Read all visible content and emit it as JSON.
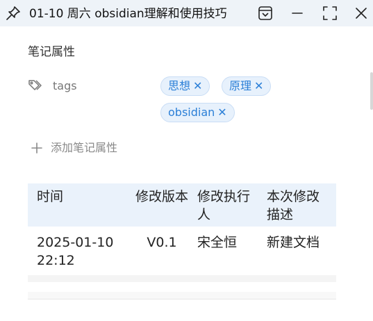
{
  "window": {
    "title": "01-10 周六 obsidian理解和使用技巧"
  },
  "properties": {
    "heading": "笔记属性",
    "tags_key": "tags",
    "tags": [
      "思想",
      "原理",
      "obsidian"
    ],
    "tag_remove_glyph": "✕",
    "add_label": "添加笔记属性"
  },
  "table": {
    "headers": [
      "时间",
      "修改版本",
      "修改执行人",
      "本次修改描述"
    ],
    "rows": [
      [
        "2025-01-10 22:12",
        "V0.1",
        "宋全恒",
        "新建文档"
      ]
    ]
  },
  "colors": {
    "titlebar_bg": "#eef3f8",
    "tag_text": "#2b7fd7",
    "tag_bg": "#e7f1fc",
    "table_header_bg": "#eaf2fb"
  }
}
